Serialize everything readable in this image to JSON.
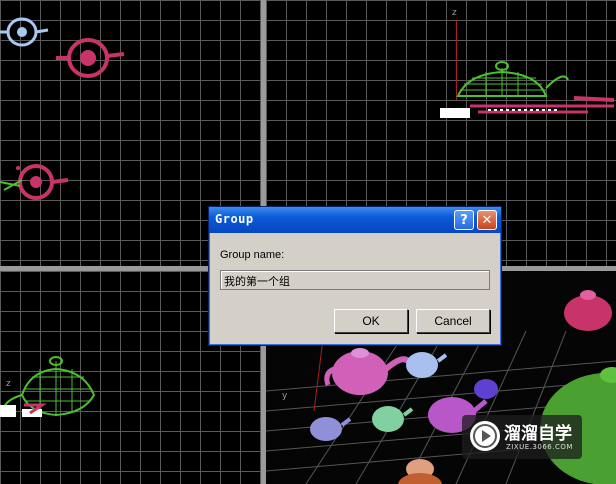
{
  "viewports": {
    "top_left": {
      "name": "top-viewport"
    },
    "top_right": {
      "name": "front-viewport",
      "axis_z": "z"
    },
    "bottom_left": {
      "name": "left-viewport",
      "axis_z": "z"
    },
    "bottom_right": {
      "name": "perspective-viewport",
      "axis_y": "y"
    }
  },
  "dialog": {
    "title": "Group",
    "help_label": "?",
    "close_label": "✕",
    "group_name_label": "Group name:",
    "group_name_value": "我的第一个组",
    "ok_label": "OK",
    "cancel_label": "Cancel"
  },
  "watermark": {
    "main": "溜溜自学",
    "sub": "ZIXUE.3066.COM"
  },
  "colors": {
    "titlebar": "#0a5ad8",
    "grid": "#5a5a5a",
    "teapot_pink": "#c8346a",
    "teapot_green": "#4cc030",
    "teapot_lightblue": "#a8c8f0"
  }
}
